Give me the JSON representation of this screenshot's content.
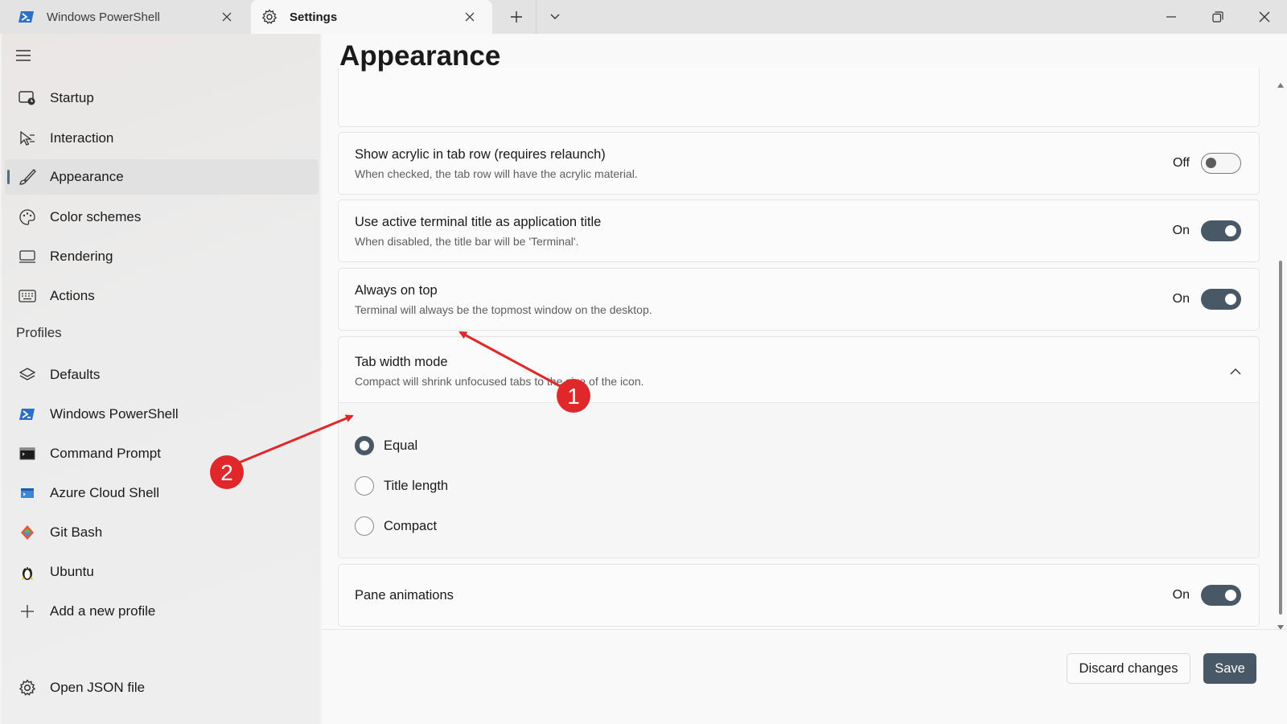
{
  "tabs": [
    {
      "label": "Windows PowerShell",
      "icon": "powershell-icon"
    },
    {
      "label": "Settings",
      "icon": "gear-icon"
    }
  ],
  "sidebar": {
    "items": [
      {
        "label": "Startup",
        "icon": "startup-icon"
      },
      {
        "label": "Interaction",
        "icon": "interaction-icon"
      },
      {
        "label": "Appearance",
        "icon": "brush-icon",
        "selected": true
      },
      {
        "label": "Color schemes",
        "icon": "palette-icon"
      },
      {
        "label": "Rendering",
        "icon": "monitor-icon"
      },
      {
        "label": "Actions",
        "icon": "keyboard-icon"
      }
    ],
    "profiles_label": "Profiles",
    "profiles": [
      {
        "label": "Defaults",
        "icon": "layers-icon"
      },
      {
        "label": "Windows PowerShell",
        "icon": "powershell-icon"
      },
      {
        "label": "Command Prompt",
        "icon": "cmd-icon"
      },
      {
        "label": "Azure Cloud Shell",
        "icon": "azure-icon"
      },
      {
        "label": "Git Bash",
        "icon": "git-icon"
      },
      {
        "label": "Ubuntu",
        "icon": "linux-icon"
      },
      {
        "label": "Add a new profile",
        "icon": "plus-icon"
      }
    ],
    "open_json": {
      "label": "Open JSON file",
      "icon": "gear-icon"
    }
  },
  "main": {
    "title": "Appearance",
    "settings": [
      {
        "title": "Show acrylic in tab row (requires relaunch)",
        "desc": "When checked, the tab row will have the acrylic material.",
        "state": "Off"
      },
      {
        "title": "Use active terminal title as application title",
        "desc": "When disabled, the title bar will be 'Terminal'.",
        "state": "On"
      },
      {
        "title": "Always on top",
        "desc": "Terminal will always be the topmost window on the desktop.",
        "state": "On"
      }
    ],
    "tab_width": {
      "title": "Tab width mode",
      "desc": "Compact will shrink unfocused tabs to the size of the icon.",
      "options": [
        "Equal",
        "Title length",
        "Compact"
      ],
      "selected": "Equal"
    },
    "pane_animations": {
      "title": "Pane animations",
      "state": "On"
    }
  },
  "footer": {
    "discard_label": "Discard changes",
    "save_label": "Save"
  },
  "annotations": [
    {
      "number": "1"
    },
    {
      "number": "2"
    }
  ],
  "colors": {
    "accent": "#485866",
    "annotation": "#e0282b"
  }
}
